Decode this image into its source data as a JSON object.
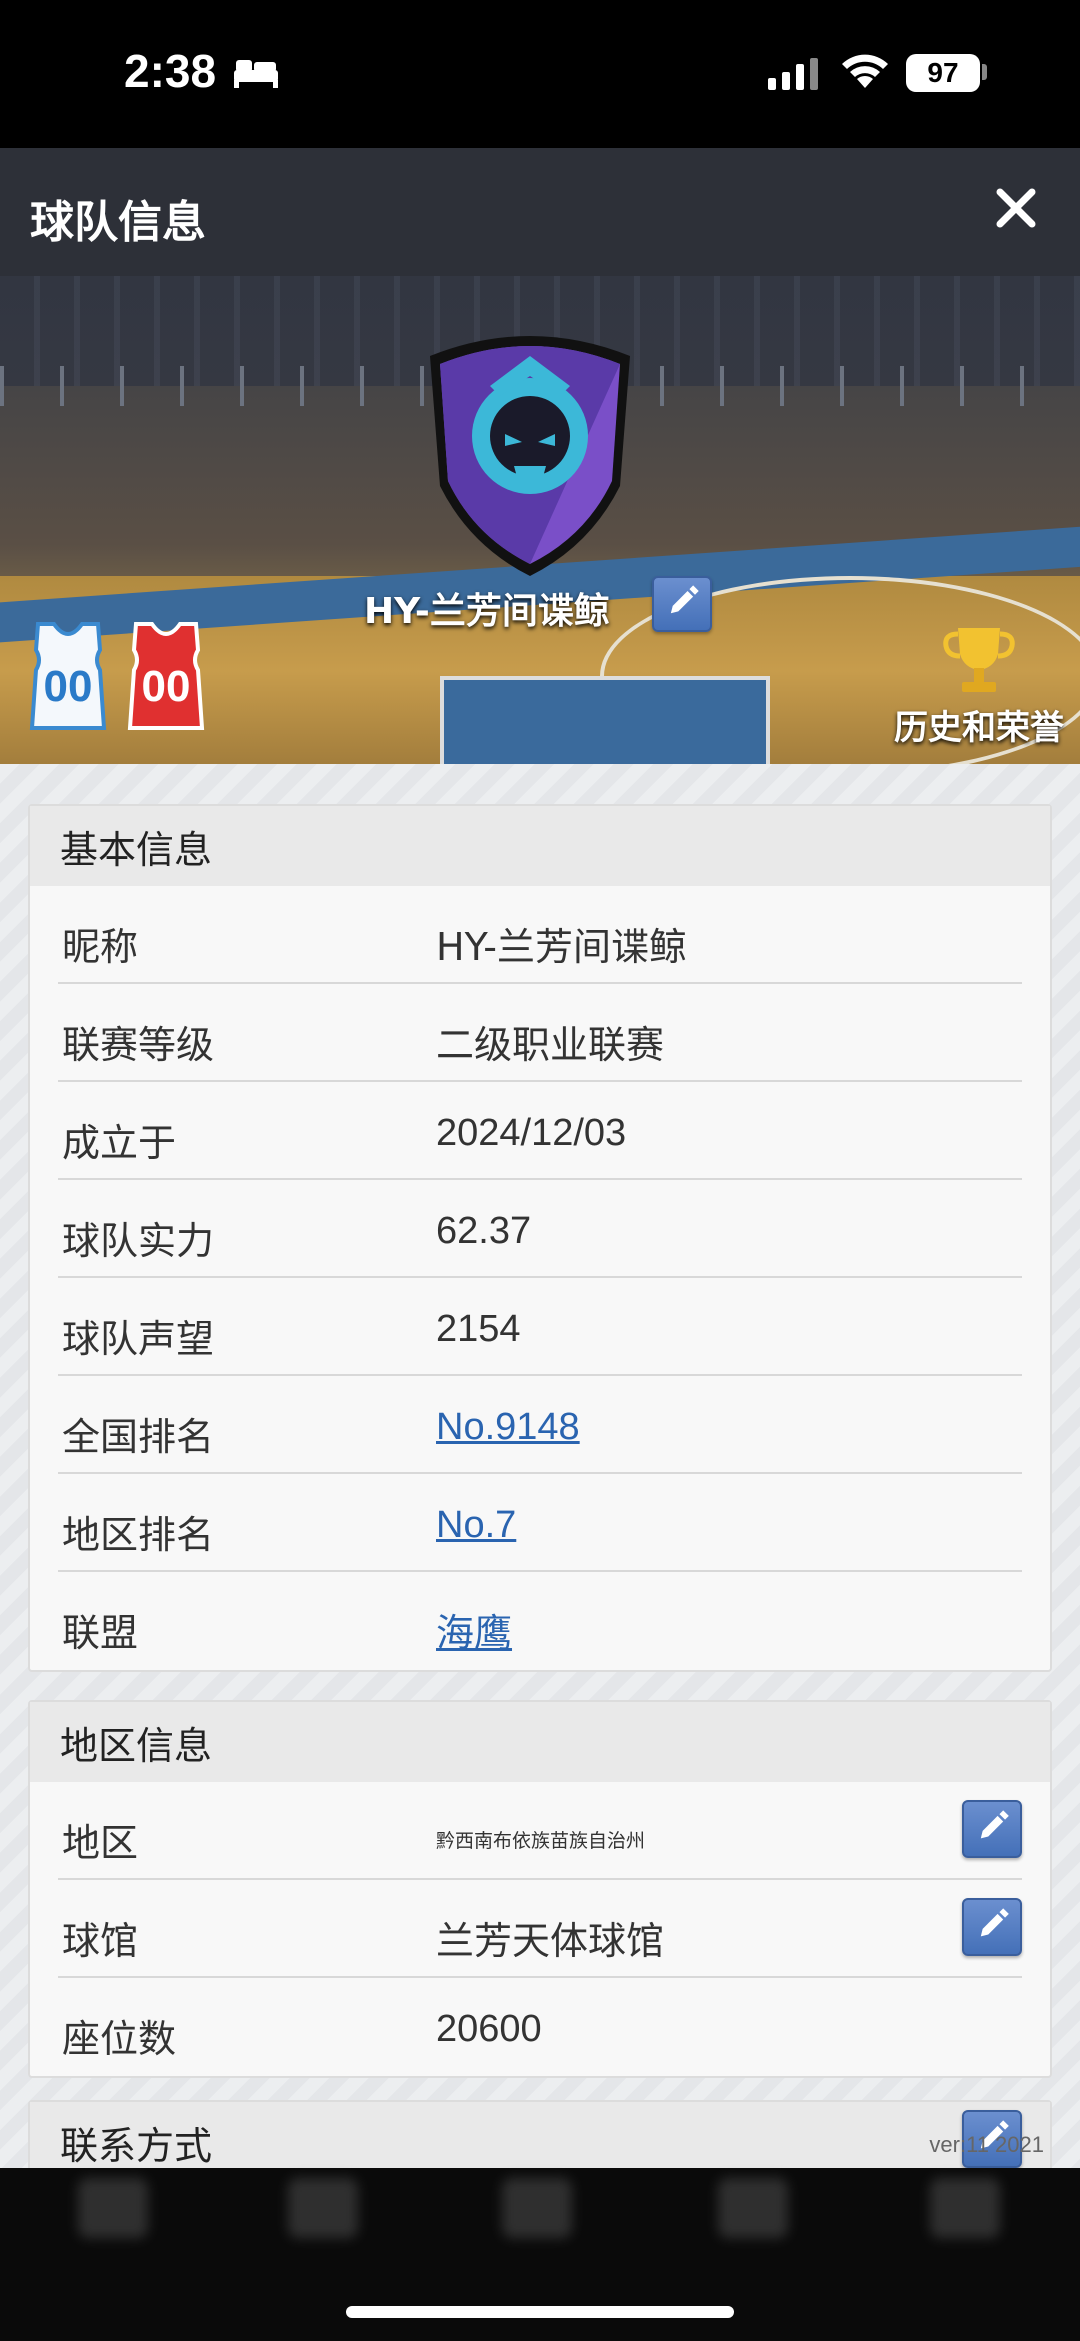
{
  "status_bar": {
    "time": "2:38",
    "battery": "97"
  },
  "header": {
    "title": "球队信息"
  },
  "banner": {
    "team_name": "HY-兰芳间谍鲸",
    "home_jersey_number": "00",
    "away_jersey_number": "00",
    "honor_label": "历史和荣誉"
  },
  "basic_info": {
    "title": "基本信息",
    "rows": [
      {
        "label": "昵称",
        "value": "HY-兰芳间谍鲸"
      },
      {
        "label": "联赛等级",
        "value": "二级职业联赛"
      },
      {
        "label": "成立于",
        "value": "2024/12/03"
      },
      {
        "label": "球队实力",
        "value": "62.37"
      },
      {
        "label": "球队声望",
        "value": "2154"
      },
      {
        "label": "全国排名",
        "value": "No.9148"
      },
      {
        "label": "地区排名",
        "value": "No.7"
      },
      {
        "label": "联盟",
        "value": "海鹰"
      }
    ]
  },
  "region_info": {
    "title": "地区信息",
    "rows": [
      {
        "label": "地区",
        "value": "黔西南布依族苗族自治州"
      },
      {
        "label": "球馆",
        "value": "兰芳天体球馆"
      },
      {
        "label": "座位数",
        "value": "20600"
      }
    ]
  },
  "contact_info": {
    "title": "联系方式"
  },
  "footer": {
    "version": "ver:11  2021"
  },
  "colors": {
    "header_bg": "#2d3038",
    "link": "#2a64b0",
    "edit_button": "#4470b8"
  }
}
